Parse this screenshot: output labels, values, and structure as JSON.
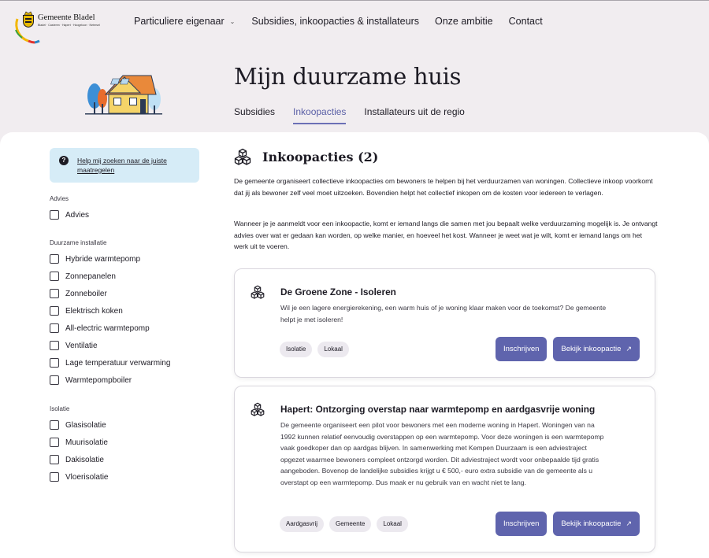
{
  "logo": {
    "title": "Gemeente Bladel",
    "subtitle": "Bladel · Casteren · Hapert · Hoogeloon · Netersel",
    "colors": [
      "#f2b705",
      "#e2322d",
      "#2b86c5",
      "#3aa13b"
    ]
  },
  "nav": [
    {
      "label": "Particuliere eigenaar",
      "has_dropdown": true
    },
    {
      "label": "Subsidies, inkoopacties & installateurs"
    },
    {
      "label": "Onze ambitie"
    },
    {
      "label": "Contact"
    }
  ],
  "hero": {
    "title": "Mijn duurzame huis",
    "tabs": [
      {
        "label": "Subsidies",
        "active": false
      },
      {
        "label": "Inkoopacties",
        "active": true
      },
      {
        "label": "Installateurs uit de regio",
        "active": false
      }
    ]
  },
  "sidebar": {
    "help_link": "Help mij zoeken naar de juiste maatregelen",
    "groups": [
      {
        "title": "Advies",
        "items": [
          "Advies"
        ]
      },
      {
        "title": "Duurzame installatie",
        "items": [
          "Hybride warmtepomp",
          "Zonnepanelen",
          "Zonneboiler",
          "Elektrisch koken",
          "All-electric warmtepomp",
          "Ventilatie",
          "Lage temperatuur verwarming",
          "Warmtepompboiler"
        ]
      },
      {
        "title": "Isolatie",
        "items": [
          "Glasisolatie",
          "Muurisolatie",
          "Dakisolatie",
          "Vloerisolatie"
        ]
      }
    ]
  },
  "content": {
    "section_title": "Inkoopacties (2)",
    "intro_1": "De gemeente organiseert collectieve inkoopacties om bewoners te helpen bij het verduurzamen van woningen. Collectieve inkoop voorkomt dat jij als bewoner zelf veel moet uitzoeken. Bovendien helpt het collectief inkopen om de kosten voor iedereen te verlagen.",
    "intro_2": "Wanneer je je aanmeldt voor een inkoopactie, komt er iemand langs die samen met jou bepaalt welke verduurzaming mogelijk is. Je ontvangt advies over wat er gedaan kan worden, op welke manier, en hoeveel het kost. Wanneer je weet wat je wilt, komt er iemand langs om het werk uit te voeren.",
    "cards": [
      {
        "title": "De Groene Zone - Isoleren",
        "description": "Wil je een lagere energierekening, een warm huis of je woning klaar maken voor de toekomst? De gemeente helpt je met isoleren!",
        "tags": [
          "Isolatie",
          "Lokaal"
        ],
        "btn_signup": "Inschrijven",
        "btn_view": "Bekijk inkoopactie",
        "btn_view_icon": "↗"
      },
      {
        "title": "Hapert: Ontzorging overstap naar warmtepomp en aardgasvrije woning",
        "description": "De gemeente organiseert een pilot voor bewoners met een moderne woning in Hapert. Woningen van na 1992 kunnen relatief eenvoudig overstappen op een warmtepomp. Voor deze woningen is een warmtepomp vaak goedkoper dan op aardgas blijven. In samenwerking met Kempen Duurzaam is een adviestraject opgezet waarmee bewoners compleet ontzorgd worden. Dit adviestraject wordt voor onbepaalde tijd gratis aangeboden. Bovenop de landelijke subsidies krijgt u € 500,- euro extra subsidie van de gemeente als u overstapt op een warmtepomp. Dus maak er nu gebruik van en wacht niet te lang.",
        "tags": [
          "Aardgasvrij",
          "Gemeente",
          "Lokaal"
        ],
        "btn_signup": "Inschrijven",
        "btn_view": "Bekijk inkoopactie",
        "btn_view_icon": "↗"
      }
    ]
  },
  "colors": {
    "accent": "#5f64ad",
    "page_bg": "#f1edf0",
    "help_bg": "#d6ecf7",
    "tag_bg": "#ece9ef"
  }
}
